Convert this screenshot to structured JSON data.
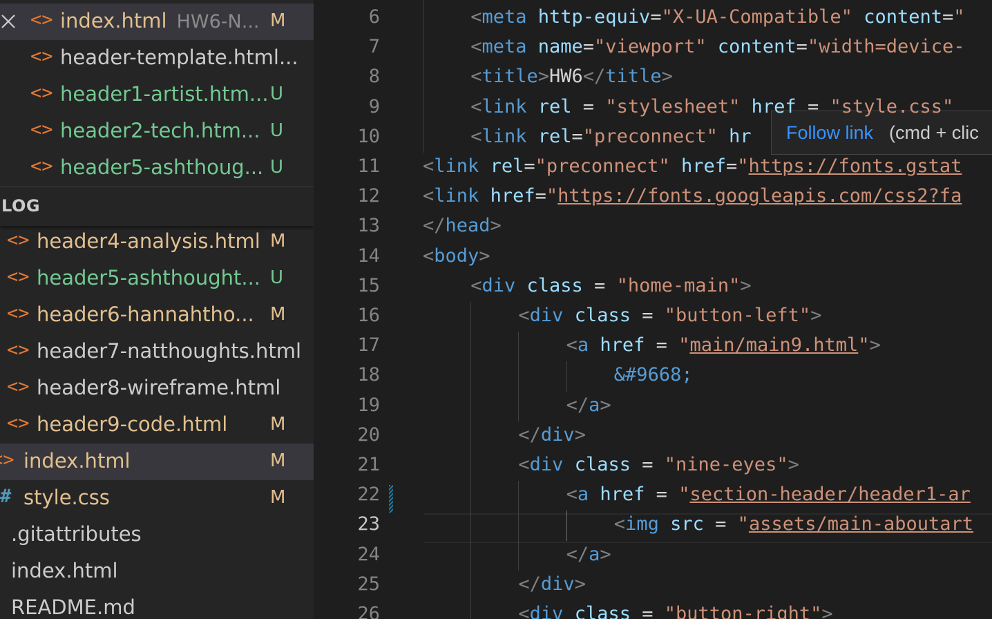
{
  "explorer": {
    "open_editors": [
      {
        "name": "index.html",
        "desc": "HW6-N...",
        "badge": "M",
        "status": "m",
        "active": true,
        "close": true
      },
      {
        "name": "header-template.html...",
        "desc": "",
        "badge": "",
        "status": "w"
      },
      {
        "name": "header1-artist.htm...",
        "desc": "",
        "badge": "U",
        "status": "u"
      },
      {
        "name": "header2-tech.htm...",
        "desc": "",
        "badge": "U",
        "status": "u"
      },
      {
        "name": "header5-ashthoug...",
        "desc": "",
        "badge": "U",
        "status": "u"
      }
    ],
    "section_title": "LOG",
    "files": [
      {
        "name": "header4-analysis.html",
        "badge": "M",
        "status": "m",
        "icon": "html"
      },
      {
        "name": "header5-ashthought...",
        "badge": "U",
        "status": "u",
        "icon": "html"
      },
      {
        "name": "header6-hannahtho...",
        "badge": "M",
        "status": "m",
        "icon": "html"
      },
      {
        "name": "header7-natthoughts.html",
        "badge": "",
        "status": "w",
        "icon": "html"
      },
      {
        "name": "header8-wireframe.html",
        "badge": "",
        "status": "w",
        "icon": "html"
      },
      {
        "name": "header9-code.html",
        "badge": "M",
        "status": "m",
        "icon": "html"
      },
      {
        "name": "index.html",
        "badge": "M",
        "status": "m",
        "icon": "html",
        "active": true
      },
      {
        "name": "style.css",
        "badge": "M",
        "status": "m",
        "icon": "css"
      },
      {
        "name": ".gitattributes",
        "badge": "",
        "status": "s",
        "icon": "none"
      },
      {
        "name": "index.html",
        "badge": "",
        "status": "s",
        "icon": "none"
      },
      {
        "name": "README.md",
        "badge": "",
        "status": "s",
        "icon": "none"
      }
    ]
  },
  "editor": {
    "current_line": 23,
    "lines": [
      {
        "n": 6,
        "indent": 2,
        "tokens": [
          [
            "t",
            "<"
          ],
          [
            "n",
            "meta"
          ],
          [
            "s",
            " "
          ],
          [
            "a",
            "http-equiv"
          ],
          [
            "p",
            "="
          ],
          [
            "v",
            "\"X-UA-Compatible\""
          ],
          [
            "s",
            " "
          ],
          [
            "a",
            "content"
          ],
          [
            "p",
            "="
          ],
          [
            "v",
            "\""
          ]
        ]
      },
      {
        "n": 7,
        "indent": 2,
        "tokens": [
          [
            "t",
            "<"
          ],
          [
            "n",
            "meta"
          ],
          [
            "s",
            " "
          ],
          [
            "a",
            "name"
          ],
          [
            "p",
            "="
          ],
          [
            "v",
            "\"viewport\""
          ],
          [
            "s",
            " "
          ],
          [
            "a",
            "content"
          ],
          [
            "p",
            "="
          ],
          [
            "v",
            "\"width=device-"
          ]
        ]
      },
      {
        "n": 8,
        "indent": 2,
        "tokens": [
          [
            "t",
            "<"
          ],
          [
            "n",
            "title"
          ],
          [
            "t",
            ">"
          ],
          [
            "p",
            "HW6"
          ],
          [
            "t",
            "</"
          ],
          [
            "n",
            "title"
          ],
          [
            "t",
            ">"
          ]
        ]
      },
      {
        "n": 9,
        "indent": 2,
        "tokens": [
          [
            "t",
            "<"
          ],
          [
            "n",
            "link"
          ],
          [
            "s",
            " "
          ],
          [
            "a",
            "rel"
          ],
          [
            "p",
            " = "
          ],
          [
            "v",
            "\"stylesheet\""
          ],
          [
            "s",
            " "
          ],
          [
            "a",
            "href"
          ],
          [
            "p",
            " = "
          ],
          [
            "v",
            "\"style.css\""
          ]
        ]
      },
      {
        "n": 10,
        "indent": 2,
        "tokens": [
          [
            "t",
            "<"
          ],
          [
            "n",
            "link"
          ],
          [
            "s",
            " "
          ],
          [
            "a",
            "rel"
          ],
          [
            "p",
            "="
          ],
          [
            "v",
            "\"preconnect\""
          ],
          [
            "s",
            " "
          ],
          [
            "a",
            "hr"
          ]
        ]
      },
      {
        "n": 11,
        "indent": 0,
        "tokens": [
          [
            "t",
            "<"
          ],
          [
            "n",
            "link"
          ],
          [
            "s",
            " "
          ],
          [
            "a",
            "rel"
          ],
          [
            "p",
            "="
          ],
          [
            "v",
            "\"preconnect\""
          ],
          [
            "s",
            " "
          ],
          [
            "a",
            "href"
          ],
          [
            "p",
            "="
          ],
          [
            "v",
            "\""
          ],
          [
            "vu",
            "https://fonts.gstat"
          ]
        ]
      },
      {
        "n": 12,
        "indent": 0,
        "tokens": [
          [
            "t",
            "<"
          ],
          [
            "n",
            "link"
          ],
          [
            "s",
            " "
          ],
          [
            "a",
            "href"
          ],
          [
            "p",
            "="
          ],
          [
            "v",
            "\""
          ],
          [
            "vu",
            "https://fonts.googleapis.com/css2?fa"
          ]
        ]
      },
      {
        "n": 13,
        "indent": 0,
        "tokens": [
          [
            "t",
            "</"
          ],
          [
            "n",
            "head"
          ],
          [
            "t",
            ">"
          ]
        ]
      },
      {
        "n": 14,
        "indent": 0,
        "tokens": [
          [
            "t",
            "<"
          ],
          [
            "n",
            "body"
          ],
          [
            "t",
            ">"
          ]
        ]
      },
      {
        "n": 15,
        "indent": 2,
        "tokens": [
          [
            "t",
            "<"
          ],
          [
            "n",
            "div"
          ],
          [
            "s",
            " "
          ],
          [
            "a",
            "class"
          ],
          [
            "p",
            " = "
          ],
          [
            "v",
            "\"home-main\""
          ],
          [
            "t",
            ">"
          ]
        ]
      },
      {
        "n": 16,
        "indent": 4,
        "tokens": [
          [
            "t",
            "<"
          ],
          [
            "n",
            "div"
          ],
          [
            "s",
            " "
          ],
          [
            "a",
            "class"
          ],
          [
            "p",
            " = "
          ],
          [
            "v",
            "\"button-left\""
          ],
          [
            "t",
            ">"
          ]
        ]
      },
      {
        "n": 17,
        "indent": 6,
        "tokens": [
          [
            "t",
            "<"
          ],
          [
            "n",
            "a"
          ],
          [
            "s",
            " "
          ],
          [
            "a",
            "href"
          ],
          [
            "p",
            " = "
          ],
          [
            "v",
            "\""
          ],
          [
            "vu",
            "main/main9.html"
          ],
          [
            "v",
            "\""
          ],
          [
            "t",
            ">"
          ]
        ]
      },
      {
        "n": 18,
        "indent": 8,
        "tokens": [
          [
            "n",
            "&#9668;"
          ]
        ]
      },
      {
        "n": 19,
        "indent": 6,
        "tokens": [
          [
            "t",
            "</"
          ],
          [
            "n",
            "a"
          ],
          [
            "t",
            ">"
          ]
        ]
      },
      {
        "n": 20,
        "indent": 4,
        "tokens": [
          [
            "t",
            "</"
          ],
          [
            "n",
            "div"
          ],
          [
            "t",
            ">"
          ]
        ]
      },
      {
        "n": 21,
        "indent": 4,
        "tokens": [
          [
            "t",
            "<"
          ],
          [
            "n",
            "div"
          ],
          [
            "s",
            " "
          ],
          [
            "a",
            "class"
          ],
          [
            "p",
            " = "
          ],
          [
            "v",
            "\"nine-eyes\""
          ],
          [
            "t",
            ">"
          ]
        ]
      },
      {
        "n": 22,
        "indent": 6,
        "tokens": [
          [
            "t",
            "<"
          ],
          [
            "n",
            "a"
          ],
          [
            "s",
            " "
          ],
          [
            "a",
            "href"
          ],
          [
            "p",
            " = "
          ],
          [
            "v",
            "\""
          ],
          [
            "vu",
            "section-header/header1-ar"
          ]
        ]
      },
      {
        "n": 23,
        "indent": 8,
        "tokens": [
          [
            "t",
            "<"
          ],
          [
            "n",
            "img"
          ],
          [
            "s",
            " "
          ],
          [
            "a",
            "src"
          ],
          [
            "p",
            " = "
          ],
          [
            "v",
            "\""
          ],
          [
            "vu",
            "assets/main-aboutart"
          ]
        ]
      },
      {
        "n": 24,
        "indent": 6,
        "tokens": [
          [
            "t",
            "</"
          ],
          [
            "n",
            "a"
          ],
          [
            "t",
            ">"
          ]
        ]
      },
      {
        "n": 25,
        "indent": 4,
        "tokens": [
          [
            "t",
            "</"
          ],
          [
            "n",
            "div"
          ],
          [
            "t",
            ">"
          ]
        ]
      },
      {
        "n": 26,
        "indent": 4,
        "tokens": [
          [
            "t",
            "<"
          ],
          [
            "n",
            "div"
          ],
          [
            "s",
            " "
          ],
          [
            "a",
            "class"
          ],
          [
            "p",
            " = "
          ],
          [
            "v",
            "\"button-right\""
          ],
          [
            "t",
            ">"
          ]
        ]
      }
    ]
  },
  "hover": {
    "link": "Follow link",
    "keys": "(cmd + clic"
  }
}
